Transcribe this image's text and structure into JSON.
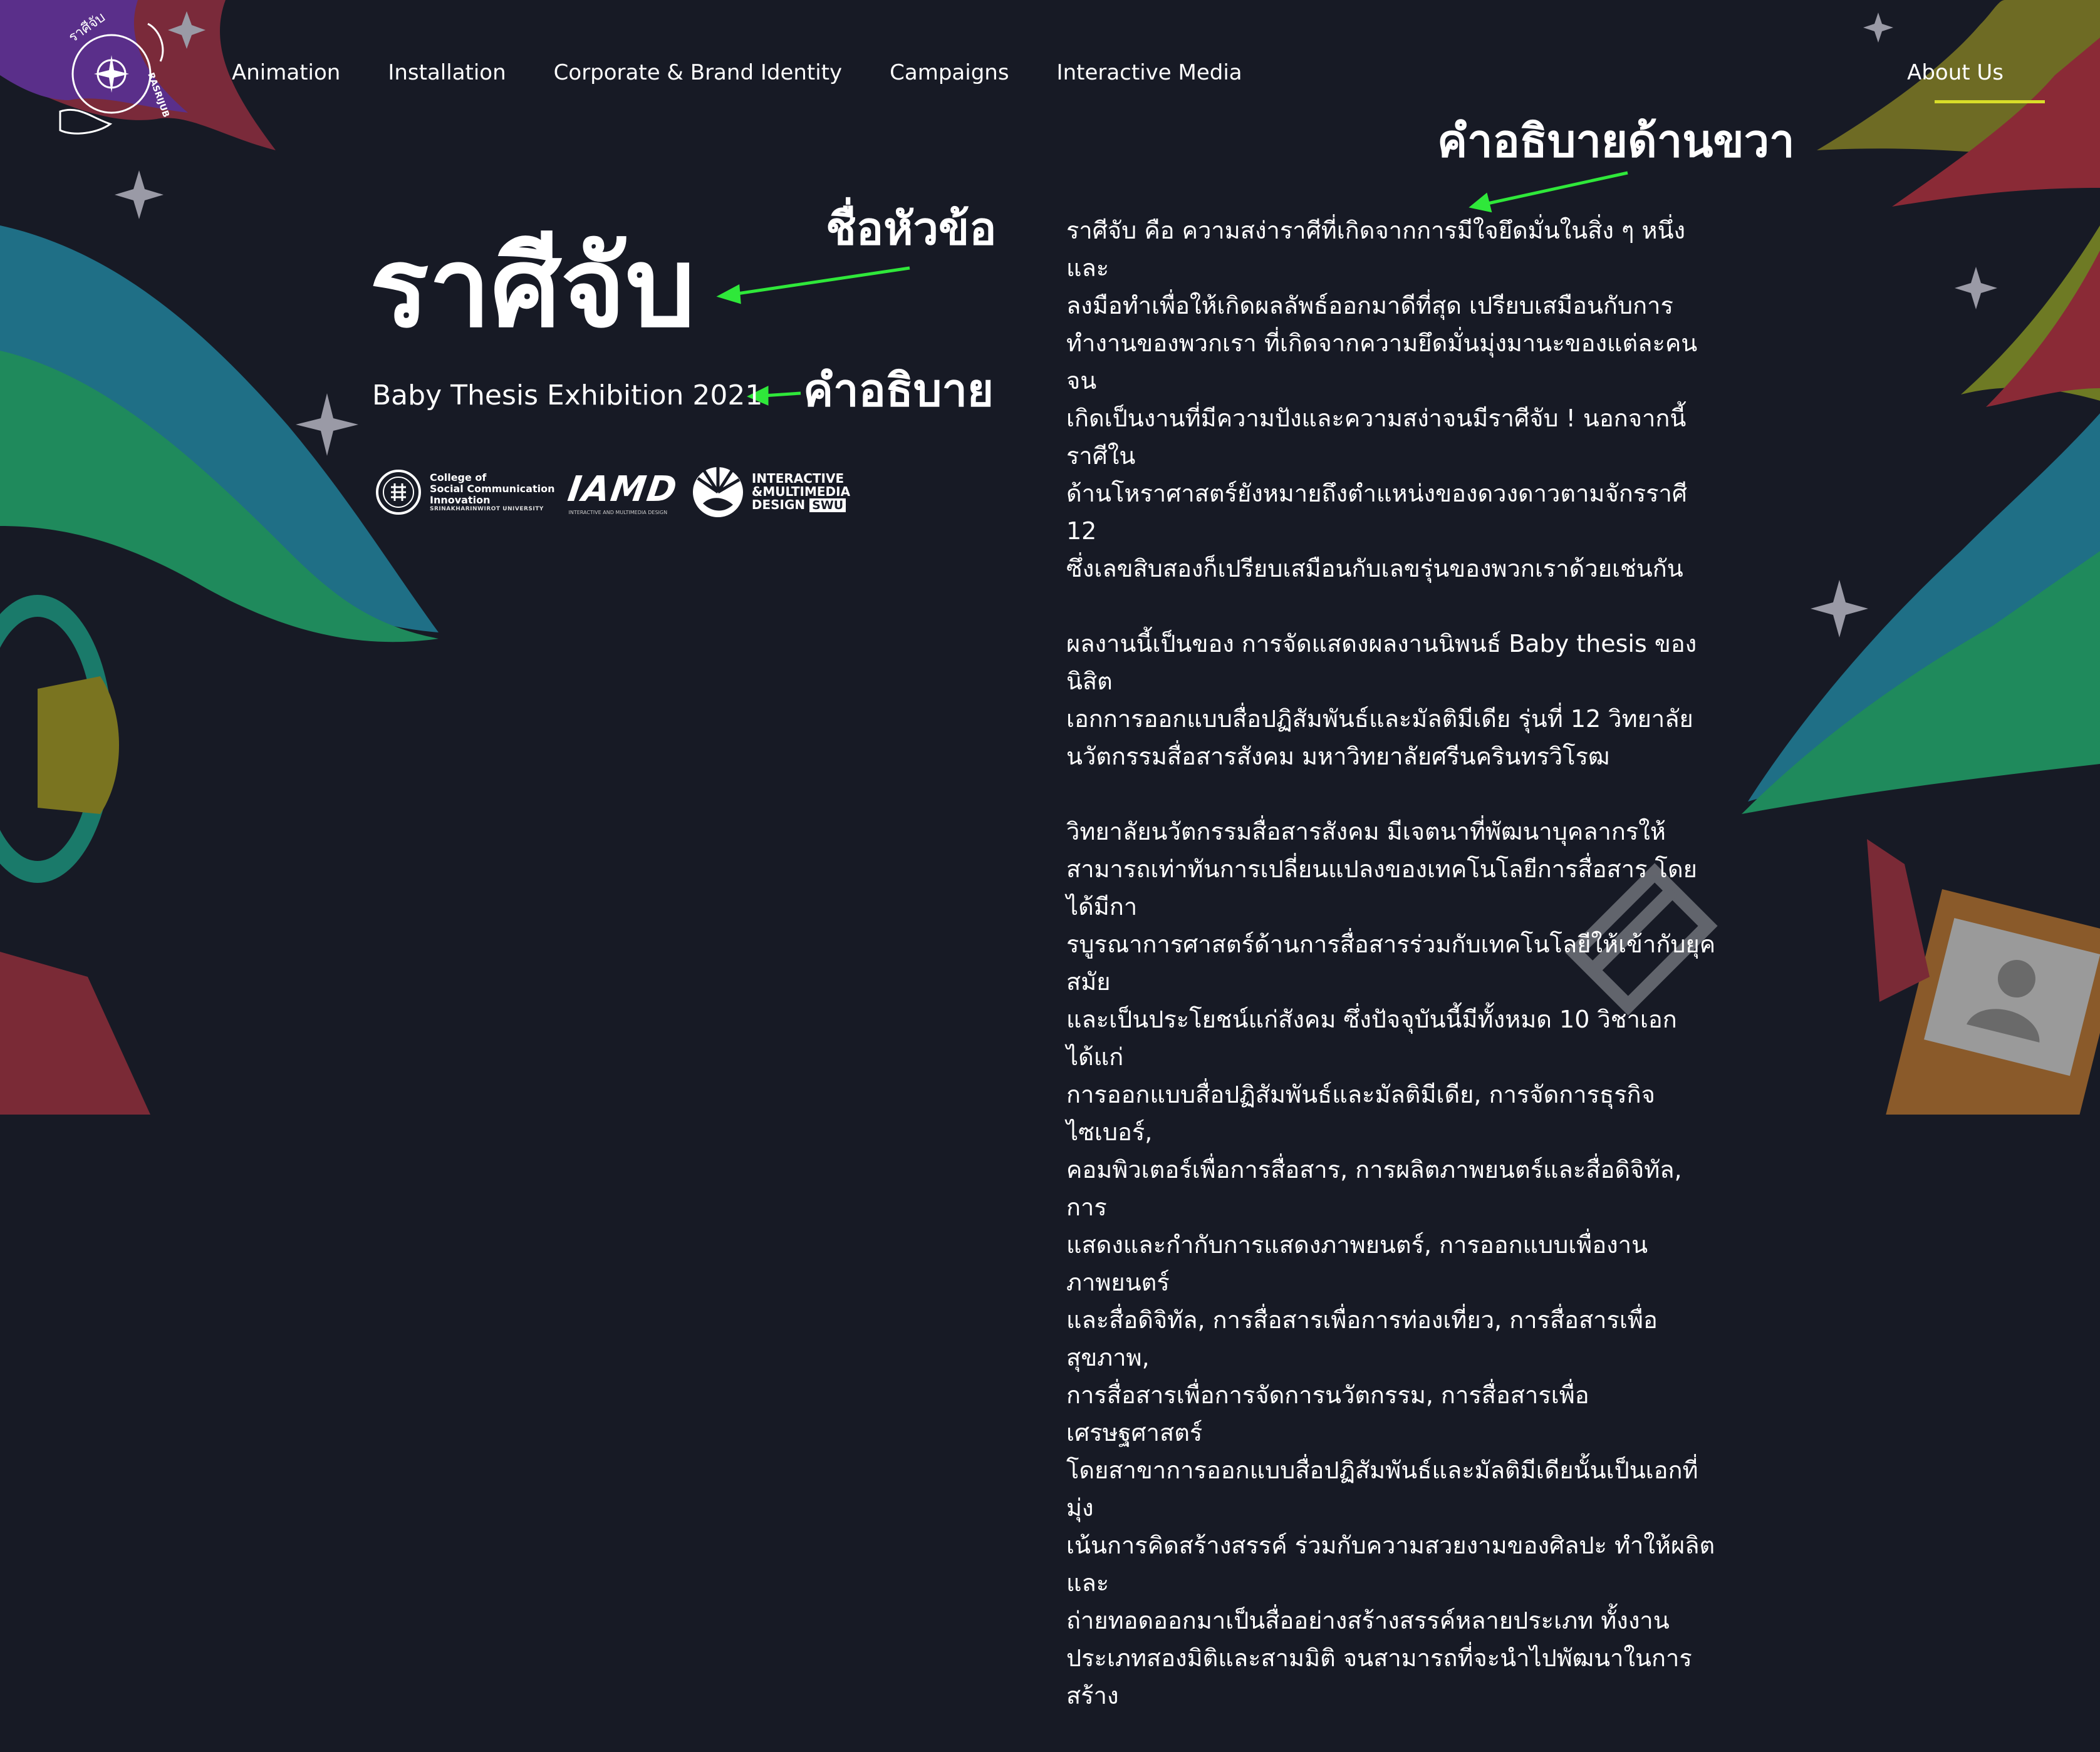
{
  "nav": {
    "items": [
      "Animation",
      "Installation",
      "Corporate & Brand Identity",
      "Campaigns",
      "Interactive Media"
    ],
    "about": "About Us"
  },
  "logo": {
    "text_top": "ราศีจับ",
    "text_side": "RASRIJUB"
  },
  "hero": {
    "title": "ราศีจับ",
    "subtitle": "Baby Thesis Exhibition 2021"
  },
  "partner_logos": {
    "college_line1": "College of",
    "college_line2": "Social Communication",
    "college_line3": "Innovation",
    "college_sub": "SRINAKHARINWIROT UNIVERSITY",
    "iamd": "IAMD",
    "iamd_sub": "INTERACTIVE AND MULTIMEDIA DESIGN",
    "imd_line1": "INTERACTIVE",
    "imd_line2": "&MULTIMEDIA",
    "imd_line3": "DESIGN",
    "imd_swu": "SWU"
  },
  "annotations": {
    "topic": "ชื่อหัวข้อ",
    "description": "คำอธิบาย",
    "right_description": "คำอธิบายด้านขวา"
  },
  "body": {
    "p1": [
      "ราศีจับ คือ ความสง่าราศีที่เกิดจากการมีใจยึดมั่นในสิ่ง ๆ หนึ่ง และ",
      "ลงมือทำเพื่อให้เกิดผลลัพธ์ออกมาดีที่สุด เปรียบเสมือนกับการ",
      "ทำงานของพวกเรา ที่เกิดจากความยึดมั่นมุ่งมานะของแต่ละคน จน",
      "เกิดเป็นงานที่มีความปังและความสง่าจนมีราศีจับ ! นอกจากนี้ราศีใน",
      "ด้านโหราศาสตร์ยังหมายถึงตำแหน่งของดวงดาวตามจักรราศี 12",
      "ซึ่งเลขสิบสองก็เปรียบเสมือนกับเลขรุ่นของพวกเราด้วยเช่นกัน"
    ],
    "p2": [
      "ผลงานนี้เป็นของ การจัดแสดงผลงานนิพนธ์ Baby thesis ของนิสิต",
      "เอกการออกแบบสื่อปฏิสัมพันธ์และมัลติมีเดีย รุ่นที่ 12 วิทยาลัย",
      "นวัตกรรมสื่อสารสังคม มหาวิทยาลัยศรีนครินทรวิโรฒ"
    ],
    "p3": [
      "วิทยาลัยนวัตกรรมสื่อสารสังคม มีเจตนาที่พัฒนาบุคลากรให้",
      "สามารถเท่าทันการเปลี่ยนแปลงของเทคโนโลยีการสื่อสาร โดยได้มีกา",
      "รบูรณาการศาสตร์ด้านการสื่อสารร่วมกับเทคโนโลยีให้เข้ากับยุคสมัย",
      "และเป็นประโยชน์แก่สังคม ซึ่งปัจจุบันนี้มีทั้งหมด 10 วิชาเอก ได้แก่",
      "การออกแบบสื่อปฏิสัมพันธ์และมัลติมีเดีย, การจัดการธุรกิจไซเบอร์,",
      "คอมพิวเตอร์เพื่อการสื่อสาร, การผลิตภาพยนตร์และสื่อดิจิทัล, การ",
      "แสดงและกำกับการแสดงภาพยนตร์, การออกแบบเพื่องานภาพยนตร์",
      "และสื่อดิจิทัล, การสื่อสารเพื่อการท่องเที่ยว, การสื่อสารเพื่อสุขภาพ,",
      "การสื่อสารเพื่อการจัดการนวัตกรรม, การสื่อสารเพื่อเศรษฐศาสตร์",
      "โดยสาขาการออกแบบสื่อปฏิสัมพันธ์และมัลติมีเดียนั้นเป็นเอกที่มุ่ง",
      "เน้นการคิดสร้างสรรค์ ร่วมกับความสวยงามของศิลปะ ทำให้ผลิตและ",
      "ถ่ายทอดออกมาเป็นสื่ออย่างสร้างสรรค์หลายประเภท ทั้งงาน",
      "ประเภทสองมิติและสามมิติ จนสามารถที่จะนำไปพัฒนาในการสร้าง"
    ]
  },
  "colors": {
    "background": "#171a25",
    "accent_underline": "#d9dd29",
    "arrow": "#2fe83a",
    "wave_teal": "#1f6f86",
    "wave_green": "#1f8a5c",
    "wave_purple": "#5a2f8a",
    "wave_red": "#8a2a36",
    "wave_olive": "#6e6b24"
  }
}
